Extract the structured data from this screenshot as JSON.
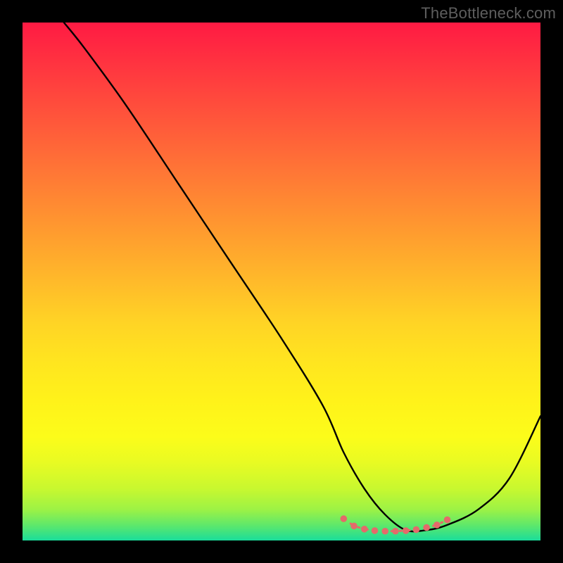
{
  "watermark": "TheBottleneck.com",
  "chart_data": {
    "type": "line",
    "title": "",
    "xlabel": "",
    "ylabel": "",
    "xlim": [
      0,
      100
    ],
    "ylim": [
      0,
      100
    ],
    "series": [
      {
        "name": "bottleneck-curve",
        "x": [
          8,
          12,
          20,
          30,
          40,
          50,
          58,
          62,
          66,
          70,
          74,
          78,
          82,
          88,
          94,
          100
        ],
        "y": [
          100,
          95,
          84,
          69,
          54,
          39,
          26,
          17,
          10,
          5,
          2,
          2,
          3,
          6,
          12,
          24
        ]
      }
    ],
    "markers": {
      "name": "highlight-dots",
      "x": [
        62,
        64,
        66,
        68,
        70,
        72,
        74,
        76,
        78,
        80,
        82
      ],
      "y": [
        4.2,
        2.8,
        2.2,
        1.9,
        1.8,
        1.8,
        1.9,
        2.1,
        2.5,
        3.0,
        4.0
      ]
    },
    "gradient_stops": [
      {
        "pos": 0,
        "color": "#ff1a43"
      },
      {
        "pos": 50,
        "color": "#ffba2a"
      },
      {
        "pos": 80,
        "color": "#fcfc1a"
      },
      {
        "pos": 100,
        "color": "#1add9b"
      }
    ]
  }
}
